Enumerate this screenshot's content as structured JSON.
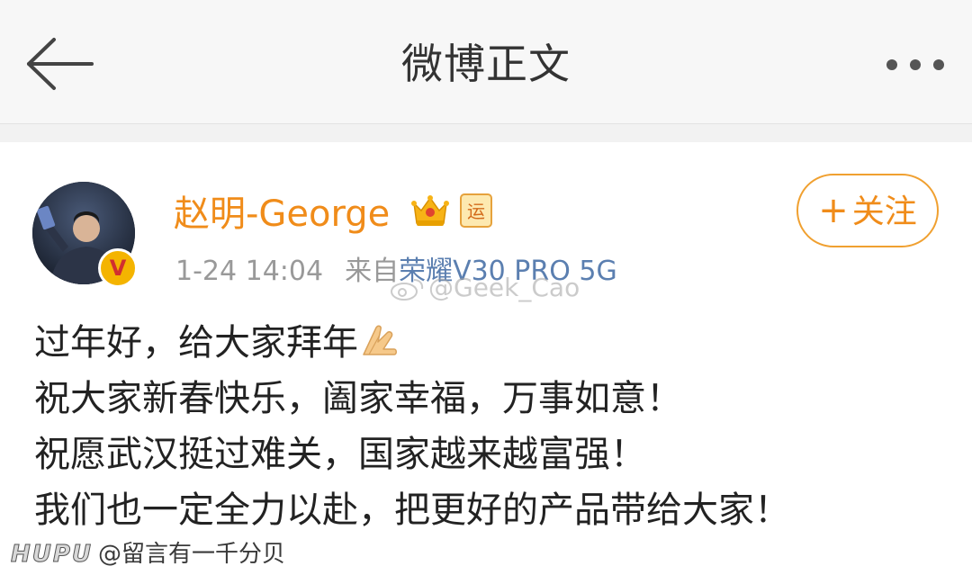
{
  "header": {
    "title": "微博正文",
    "back_icon": "arrow-left-icon",
    "more_icon": "more-dots-icon"
  },
  "post": {
    "author": {
      "name": "赵明-George",
      "verified_icon": "verified-v-icon",
      "crown_icon": "crown-badge-icon",
      "yun_icon": "yun-badge-icon",
      "yun_label": "运"
    },
    "time": "1-24 14:04",
    "source_prefix": "来自",
    "source_device": "荣耀V30 PRO 5G",
    "follow_label": "关注",
    "follow_plus": "+",
    "content_lines": [
      "过年好，给大家拜年",
      "祝大家新春快乐，阖家幸福，万事如意！",
      "祝愿武汉挺过难关，国家越来越富强！",
      "我们也一定全力以赴，把更好的产品带给大家！"
    ],
    "emoji_icon": "folded-hands-icon"
  },
  "watermarks": {
    "weibo": "@Geek_Cao",
    "hupu_brand": "HUPU",
    "hupu_user": "@留言有一千分贝"
  },
  "colors": {
    "accent": "#f08c1a",
    "link": "#5b7fb0",
    "header_bg": "#f7f7f7",
    "meta": "#999999"
  }
}
